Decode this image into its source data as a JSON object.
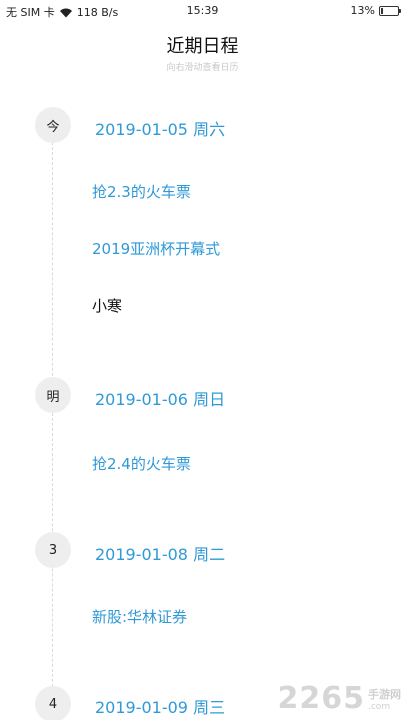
{
  "status_bar": {
    "carrier": "无 SIM 卡",
    "speed": "118 B/s",
    "time": "15:39",
    "battery": "13%",
    "battery_level": 0.13
  },
  "header": {
    "title": "近期日程",
    "subtitle": "向右滑动查看日历"
  },
  "days": [
    {
      "marker": "今",
      "date": "2019-01-05 周六",
      "events": [
        {
          "label": "抢2.3的火车票",
          "color": "blue"
        },
        {
          "label": "2019亚洲杯开幕式",
          "color": "blue"
        },
        {
          "label": "小寒",
          "color": "dark"
        }
      ]
    },
    {
      "marker": "明",
      "date": "2019-01-06 周日",
      "events": [
        {
          "label": "抢2.4的火车票",
          "color": "blue"
        }
      ]
    },
    {
      "marker": "3",
      "date": "2019-01-08 周二",
      "events": [
        {
          "label": "新股:华林证券",
          "color": "blue"
        }
      ]
    },
    {
      "marker": "4",
      "date": "2019-01-09 周三",
      "events": []
    }
  ],
  "watermark": {
    "number": "2265",
    "cn": "手游网",
    "domain": ".com"
  },
  "colors": {
    "accent": "#2f9ad6",
    "marker_bg": "#eeeeee"
  }
}
